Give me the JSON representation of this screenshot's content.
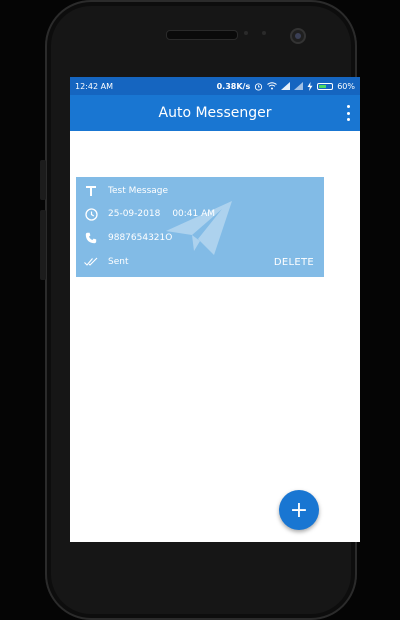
{
  "status_bar": {
    "time": "12:42 AM",
    "network_speed": "0.38K/s",
    "battery_percent": "60%",
    "battery_level": 0.6,
    "icons": [
      "alarm-icon",
      "wifi-icon",
      "signal-icon",
      "signal-icon",
      "charging-icon",
      "battery-icon"
    ]
  },
  "app_bar": {
    "title": "Auto Messenger",
    "menu_icon": "more-vert-icon"
  },
  "messages": [
    {
      "text": "Test Message",
      "date": "25-09-2018",
      "time": "00:41 AM",
      "phone": "9887654321O",
      "status": "Sent",
      "delete_label": "DELETE"
    }
  ],
  "fab": {
    "icon": "add-icon",
    "label": "+"
  },
  "colors": {
    "status_bar": "#1565C0",
    "app_bar": "#1976D2",
    "card": "#82BBE6",
    "fab": "#1976D2"
  }
}
